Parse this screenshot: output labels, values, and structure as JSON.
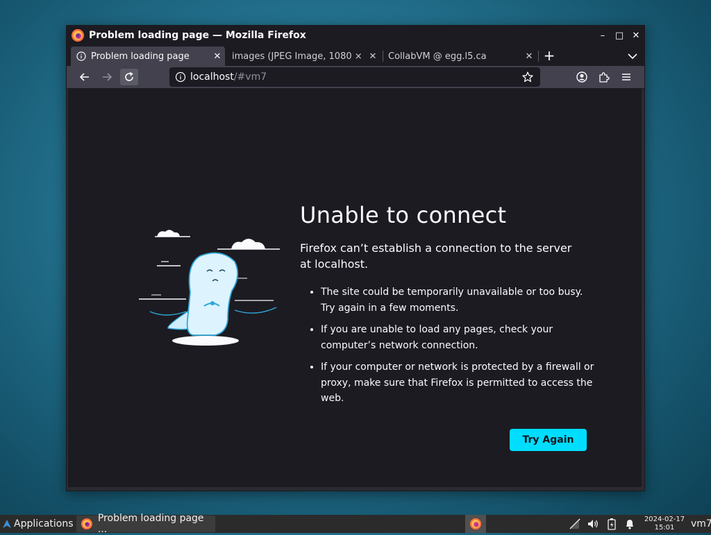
{
  "window": {
    "title": "Problem loading page — Mozilla Firefox",
    "controls": {
      "minimize": "–",
      "maximize": "□",
      "close": "✕"
    }
  },
  "tabs": [
    {
      "label": "Problem loading page",
      "active": true
    },
    {
      "label": "images (JPEG Image, 1080 ×",
      "active": false
    },
    {
      "label": "CollabVM @ egg.l5.ca",
      "active": false
    }
  ],
  "tab_close": "✕",
  "new_tab": "+",
  "urlbar": {
    "host": "localhost",
    "path": "/#vm7"
  },
  "error_page": {
    "title": "Unable to connect",
    "intro": "Firefox can’t establish a connection to the server at localhost.",
    "bullets": [
      "The site could be temporarily unavailable or too busy. Try again in a few moments.",
      "If you are unable to load any pages, check your computer’s network connection.",
      "If your computer or network is protected by a firewall or proxy, make sure that Firefox is permitted to access the web."
    ],
    "button": "Try Again"
  },
  "taskbar": {
    "applications": "Applications",
    "task_label": "Problem loading page ...",
    "date": "2024-02-17",
    "time": "15:01",
    "user": "vm7"
  },
  "colors": {
    "accent": "#00ddff",
    "page_bg": "#1c1b22",
    "toolbar": "#42414d"
  },
  "icons": [
    "firefox-icon",
    "back-icon",
    "forward-icon",
    "reload-icon",
    "info-icon",
    "star-icon",
    "account-icon",
    "extensions-icon",
    "menu-icon",
    "chevron-down-icon",
    "volume-icon",
    "battery-icon",
    "bell-icon",
    "network-icon"
  ]
}
